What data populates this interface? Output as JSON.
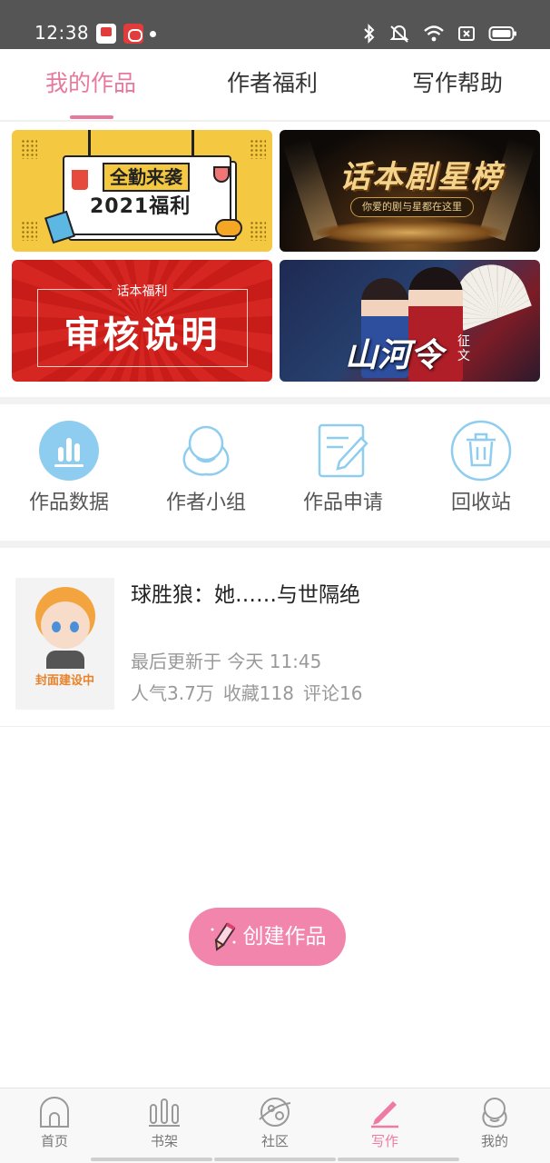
{
  "status_bar": {
    "time": "12:38"
  },
  "tabs": [
    {
      "label": "我的作品",
      "active": true
    },
    {
      "label": "作者福利",
      "active": false
    },
    {
      "label": "写作帮助",
      "active": false
    }
  ],
  "banners": {
    "welfare": {
      "line1": "全勤来袭",
      "line2": "2021福利"
    },
    "star_list": {
      "title": "话本剧星榜",
      "subtitle": "你爱的剧与星都在这里"
    },
    "review": {
      "subtitle": "话本福利",
      "title": "审核说明"
    },
    "contest": {
      "title": "山河令",
      "subtitle": "征文"
    }
  },
  "actions": [
    {
      "label": "作品数据",
      "icon": "bar-chart-icon"
    },
    {
      "label": "作者小组",
      "icon": "group-icon"
    },
    {
      "label": "作品申请",
      "icon": "edit-document-icon"
    },
    {
      "label": "回收站",
      "icon": "trash-icon"
    }
  ],
  "works": [
    {
      "title": "球胜狼：她……与世隔绝",
      "cover_text": "封面建设中",
      "updated": "最后更新于 今天 11:45",
      "popularity": "人气3.7万",
      "favorites": "收藏118",
      "comments": "评论16"
    }
  ],
  "create_button": {
    "label": "创建作品"
  },
  "bottom_nav": [
    {
      "label": "首页",
      "icon": "home-icon",
      "active": false
    },
    {
      "label": "书架",
      "icon": "bookshelf-icon",
      "active": false
    },
    {
      "label": "社区",
      "icon": "community-icon",
      "active": false
    },
    {
      "label": "写作",
      "icon": "pen-icon",
      "active": true
    },
    {
      "label": "我的",
      "icon": "profile-icon",
      "active": false
    }
  ],
  "colors": {
    "accent": "#e7799c",
    "create_button": "#f285ac",
    "action_icon": "#8fcdf0"
  }
}
